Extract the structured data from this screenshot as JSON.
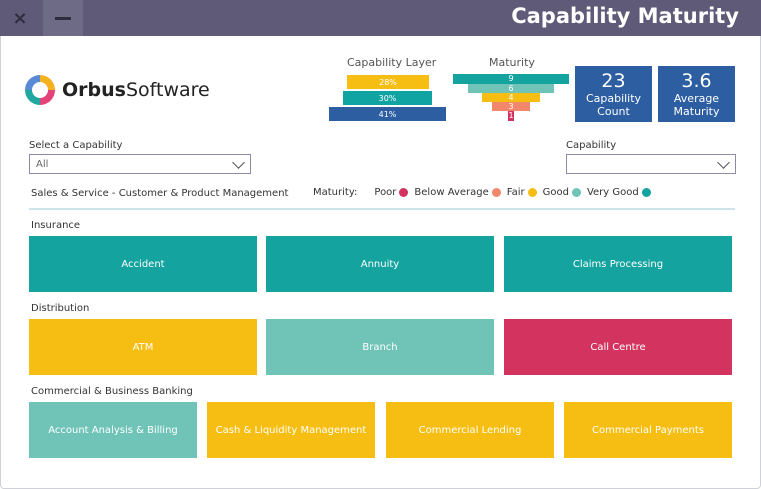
{
  "window": {
    "title": "Capability Maturity",
    "close_icon": "×"
  },
  "logo": {
    "part1": "Orbus",
    "part2": "Software"
  },
  "capability_layer": {
    "title": "Capability Layer",
    "bars": [
      {
        "label": "28%",
        "color": "#f6be12"
      },
      {
        "label": "30%",
        "color": "#0fa3a2"
      },
      {
        "label": "41%",
        "color": "#2c5ea1"
      }
    ]
  },
  "maturity_funnel": {
    "title": "Maturity",
    "bars": [
      {
        "label": "9",
        "color": "#14a39f"
      },
      {
        "label": "6",
        "color": "#6fc3b7"
      },
      {
        "label": "4",
        "color": "#f6be12"
      },
      {
        "label": "3",
        "color": "#f3876b"
      },
      {
        "label": "1",
        "color": "#d3345f"
      }
    ]
  },
  "kpis": [
    {
      "value": "23",
      "label_line1": "Capability",
      "label_line2": "Count"
    },
    {
      "value": "3.6",
      "label_line1": "Average",
      "label_line2": "Maturity"
    }
  ],
  "filters": {
    "select_capability_label": "Select a Capability",
    "select_capability_value": "All",
    "capability_label": "Capability",
    "capability_value": ""
  },
  "context_label": "Sales & Service - Customer & Product Management",
  "legend": {
    "title": "Maturity:",
    "items": [
      {
        "label": "Poor",
        "color": "#d3345f"
      },
      {
        "label": "Below Average",
        "color": "#f3876b"
      },
      {
        "label": "Fair",
        "color": "#f6be12"
      },
      {
        "label": "Good",
        "color": "#6fc3b7"
      },
      {
        "label": "Very Good",
        "color": "#14a39f"
      }
    ]
  },
  "groups": [
    {
      "name": "Insurance",
      "tiles": [
        {
          "label": "Accident",
          "color": "#14a39f"
        },
        {
          "label": "Annuity",
          "color": "#14a39f"
        },
        {
          "label": "Claims Processing",
          "color": "#14a39f"
        }
      ]
    },
    {
      "name": "Distribution",
      "tiles": [
        {
          "label": "ATM",
          "color": "#f6be12"
        },
        {
          "label": "Branch",
          "color": "#6fc3b7"
        },
        {
          "label": "Call Centre",
          "color": "#d3345f"
        }
      ]
    },
    {
      "name": "Commercial & Business Banking",
      "tiles": [
        {
          "label": "Account Analysis & Billing",
          "color": "#6fc3b7"
        },
        {
          "label": "Cash & Liquidity Management",
          "color": "#f6be12"
        },
        {
          "label": "Commercial Lending",
          "color": "#f6be12"
        },
        {
          "label": "Commercial Payments",
          "color": "#f6be12"
        }
      ]
    }
  ]
}
